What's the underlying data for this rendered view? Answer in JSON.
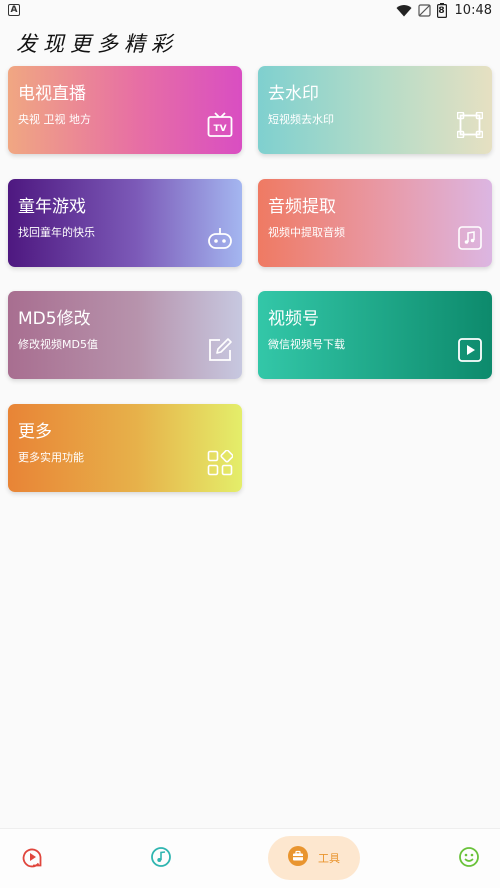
{
  "status_bar": {
    "notification_icon": "A",
    "battery_level": "8",
    "time": "10:48"
  },
  "page": {
    "title": "发现更多精彩"
  },
  "cards": {
    "tv": {
      "title": "电视直播",
      "subtitle": "央视 卫视 地方",
      "icon": "tv-icon",
      "tv_badge": "TV"
    },
    "watermark": {
      "title": "去水印",
      "subtitle": "短视频去水印",
      "icon": "crop-frame-icon"
    },
    "game": {
      "title": "童年游戏",
      "subtitle": "找回童年的快乐",
      "icon": "gamepad-icon"
    },
    "audio": {
      "title": "音频提取",
      "subtitle": "视频中提取音频",
      "icon": "music-note-icon"
    },
    "md5": {
      "title": "MD5修改",
      "subtitle": "修改视频MD5值",
      "icon": "edit-icon"
    },
    "channel": {
      "title": "视频号",
      "subtitle": "微信视频号下载",
      "icon": "play-icon"
    },
    "more": {
      "title": "更多",
      "subtitle": "更多实用功能",
      "icon": "grid-icon"
    }
  },
  "bottom_nav": {
    "tools_label": "工具",
    "active": "tools",
    "colors": {
      "video": "#e0463d",
      "music": "#2fb5b0",
      "tools": "#e9952f",
      "tools_bg": "#fde7cf",
      "me": "#69c23a"
    }
  }
}
